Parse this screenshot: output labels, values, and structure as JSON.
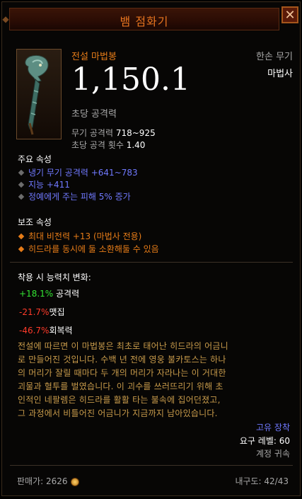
{
  "title": "뱀 점화기",
  "item": {
    "rarity_type": "전설 마법봉",
    "hand": "한손 무기",
    "class": "마법사",
    "dps": "1,150.1",
    "dps_label": "초당 공격력",
    "weapon_damage_label": "무기 공격력",
    "weapon_damage_value": "718~925",
    "attack_speed_label": "초당 공격 횟수",
    "attack_speed_value": "1.40"
  },
  "primary": {
    "header": "주요 속성",
    "items": [
      "냉기 무기 공격력 +641~783",
      "지능 +411",
      "정예에게 주는 피해 5% 증가"
    ]
  },
  "secondary": {
    "header": "보조 속성",
    "items": [
      "최대 비전력 +13 (마법사 전용)",
      "히드라를 동시에 둘 소환해둘 수 있음"
    ]
  },
  "compare": {
    "header": "착용 시 능력치 변화:",
    "rows": [
      {
        "value": "+18.1%",
        "label": "공격력",
        "color": "#33e533"
      },
      {
        "value": "-21.7%",
        "label": "맷집",
        "color": "#ff3b2a"
      },
      {
        "value": "-46.7%",
        "label": "회복력",
        "color": "#ff3b2a"
      }
    ]
  },
  "lore": [
    "전설에 따르면 이 마법봉은 최초로 태어난 히드라의 어금니",
    "로 만들어진 것입니다. 수백 년 전에 영웅 불카토스는 하나",
    "의 머리가 잘릴 때마다 두 개의 머리가 자라나는 이 거대한",
    "괴물과 혈투를 벌였습니다. 이 괴수를 쓰러뜨리기 위해 초",
    "인적인 네팔렘은 히드라를 활활 타는 불속에 집어던졌고,",
    "그 과정에서 비틀어진 어금니가 지금까지 남아있습니다."
  ],
  "meta": {
    "unique_equipped": "고유 장착",
    "required_level": "요구 레벨: 60",
    "account_bound": "계정 귀속"
  },
  "footer": {
    "sell_label": "판매가: 2626",
    "durability": "내구도: 42/43"
  },
  "colors": {
    "title": "#e6741f",
    "legendary": "#e67c18",
    "magic_affix": "#7079ff",
    "lore": "#c79a4a",
    "gain": "#33e533",
    "loss": "#ff3b2a"
  },
  "icons": [
    "close-icon",
    "gold-coin-icon",
    "wand-item-icon"
  ]
}
